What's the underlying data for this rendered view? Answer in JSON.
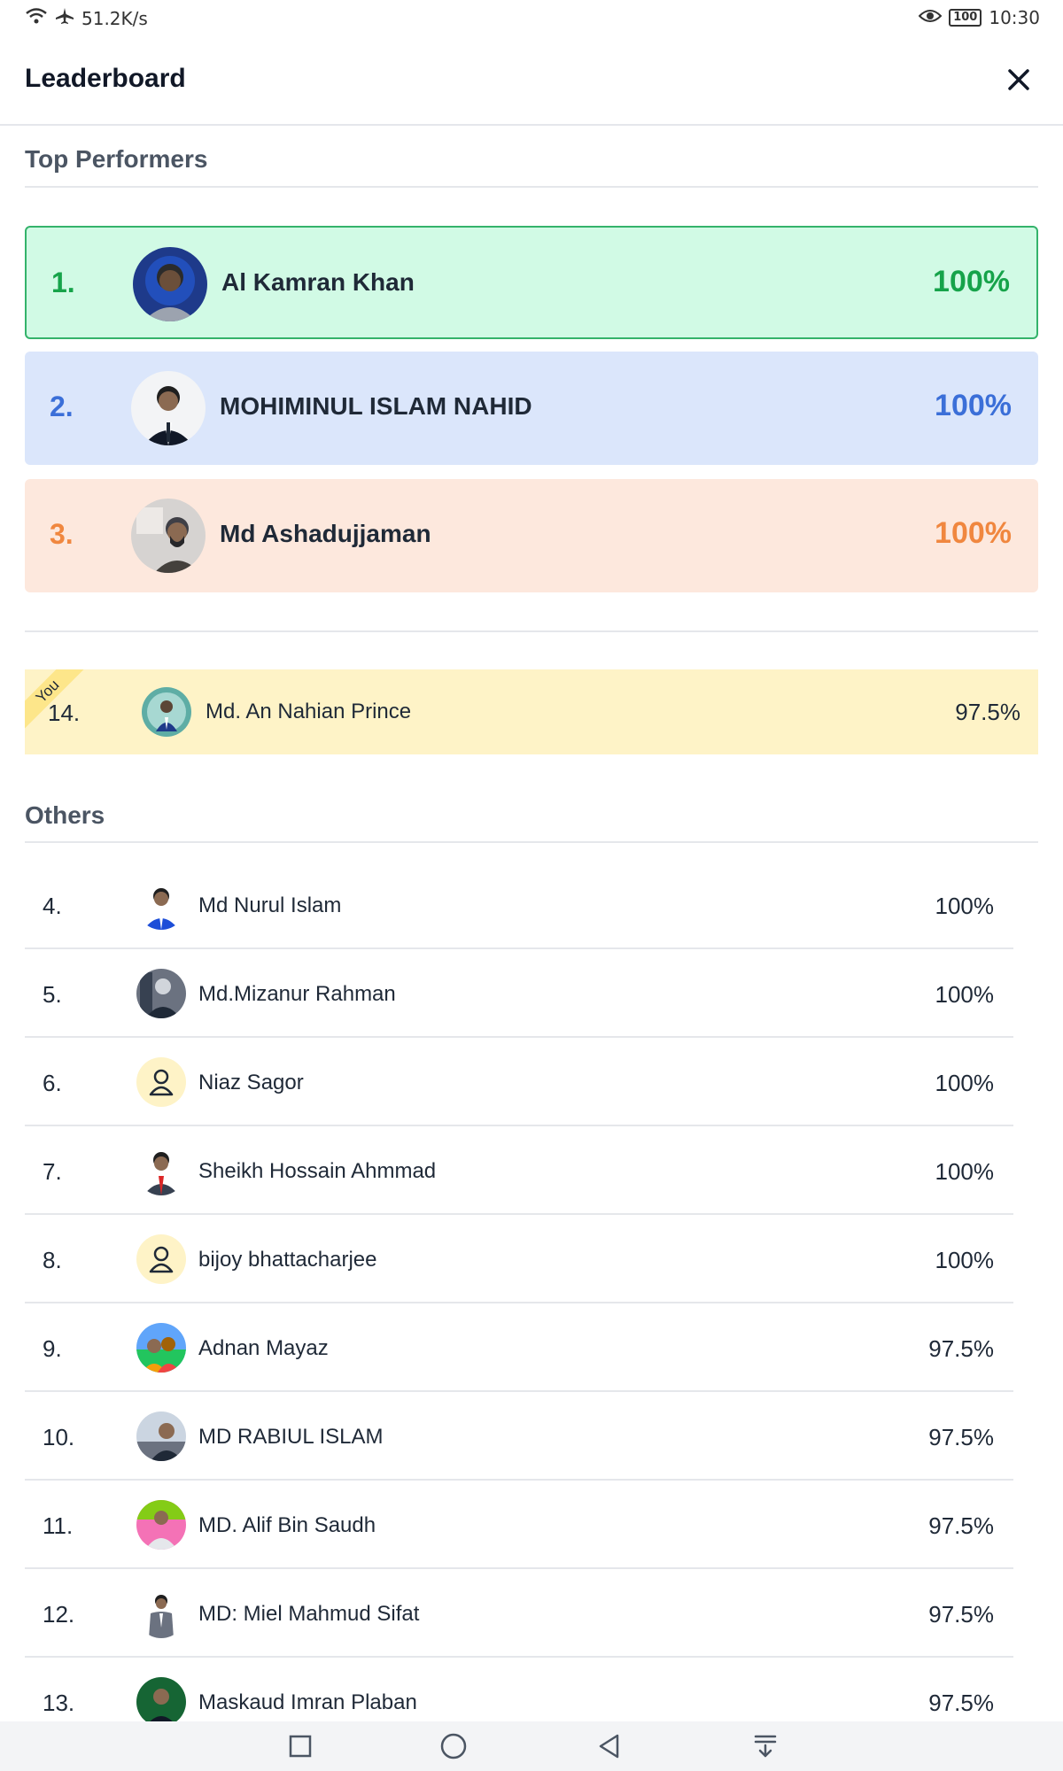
{
  "status_bar": {
    "network_speed": "51.2K/s",
    "battery": "100",
    "time": "10:30",
    "icons": [
      "wifi-icon",
      "airplane-icon",
      "eye-icon",
      "battery-icon"
    ]
  },
  "header": {
    "title": "Leaderboard",
    "close_icon": "close-icon"
  },
  "top_performers": {
    "title": "Top Performers",
    "items": [
      {
        "rank": "1.",
        "name": "Al Kamran Khan",
        "score": "100%",
        "bg": "#d1fae5",
        "border": "#34b36b",
        "accent": "#16a34a",
        "avatar": "photo"
      },
      {
        "rank": "2.",
        "name": "MOHIMINUL ISLAM NAHID",
        "score": "100%",
        "bg": "#dbe6fb",
        "border": "#dbe6fb",
        "accent": "#3b6fd8",
        "avatar": "photo"
      },
      {
        "rank": "3.",
        "name": "Md Ashadujjaman",
        "score": "100%",
        "bg": "#fde8dd",
        "border": "#fde8dd",
        "accent": "#f0873f",
        "avatar": "photo"
      }
    ]
  },
  "current_user": {
    "badge": "You",
    "rank": "14.",
    "name": "Md. An Nahian Prince",
    "score": "97.5%",
    "bg": "#fef3c7"
  },
  "others": {
    "title": "Others",
    "items": [
      {
        "rank": "4.",
        "name": "Md Nurul Islam",
        "score": "100%",
        "avatar": "photo"
      },
      {
        "rank": "5.",
        "name": "Md.Mizanur Rahman",
        "score": "100%",
        "avatar": "photo"
      },
      {
        "rank": "6.",
        "name": "Niaz Sagor",
        "score": "100%",
        "avatar": "user-icon"
      },
      {
        "rank": "7.",
        "name": "Sheikh Hossain Ahmmad",
        "score": "100%",
        "avatar": "photo"
      },
      {
        "rank": "8.",
        "name": "bijoy bhattacharjee",
        "score": "100%",
        "avatar": "user-icon"
      },
      {
        "rank": "9.",
        "name": "Adnan Mayaz",
        "score": "97.5%",
        "avatar": "photo"
      },
      {
        "rank": "10.",
        "name": "MD RABIUL ISLAM",
        "score": "97.5%",
        "avatar": "photo"
      },
      {
        "rank": "11.",
        "name": "MD. Alif Bin Saudh",
        "score": "97.5%",
        "avatar": "photo"
      },
      {
        "rank": "12.",
        "name": "MD: Miel Mahmud Sifat",
        "score": "97.5%",
        "avatar": "photo"
      },
      {
        "rank": "13.",
        "name": "Maskaud Imran Plaban",
        "score": "97.5%",
        "avatar": "photo"
      }
    ]
  },
  "nav_bar": {
    "buttons": [
      "recent-apps-icon",
      "home-icon",
      "back-icon",
      "notification-pull-icon"
    ]
  }
}
